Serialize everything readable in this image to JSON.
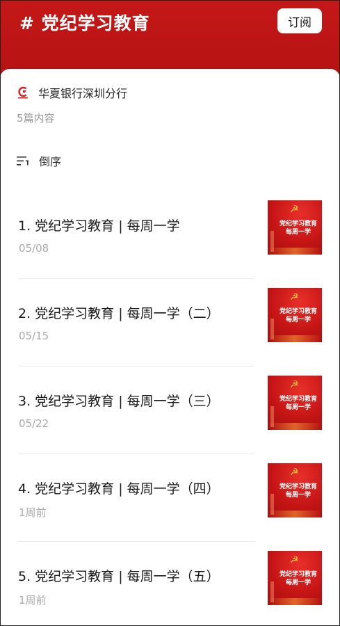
{
  "header": {
    "tag_title": "# 党纪学习教育",
    "subscribe_label": "订阅"
  },
  "account": {
    "name": "华夏银行深圳分行",
    "logo_icon": "hua-xia-bank-logo"
  },
  "count_text": "5篇内容",
  "sort": {
    "label": "倒序",
    "icon": "sort-icon"
  },
  "colors": {
    "header_red": "#c41818",
    "thumb_red": "#c51515",
    "emblem_gold": "#ffd23f"
  },
  "articles": [
    {
      "title": "1. 党纪学习教育 | 每周一学",
      "date": "05/08",
      "thumb_line1": "党纪学习教育",
      "thumb_line2": "每周一学"
    },
    {
      "title": "2. 党纪学习教育 | 每周一学（二）",
      "date": "05/15",
      "thumb_line1": "党纪学习教育",
      "thumb_line2": "每周一学"
    },
    {
      "title": "3. 党纪学习教育 | 每周一学（三）",
      "date": "05/22",
      "thumb_line1": "党纪学习教育",
      "thumb_line2": "每周一学"
    },
    {
      "title": "4. 党纪学习教育 | 每周一学（四）",
      "date": "1周前",
      "thumb_line1": "党纪学习教育",
      "thumb_line2": "每周一学"
    },
    {
      "title": "5. 党纪学习教育 | 每周一学（五）",
      "date": "1周前",
      "thumb_line1": "党纪学习教育",
      "thumb_line2": "每周一学"
    }
  ]
}
